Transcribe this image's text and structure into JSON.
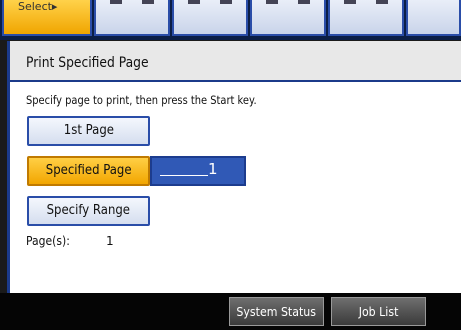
{
  "top_tabs": {
    "active_fragment": "Select▸"
  },
  "panel": {
    "title": "Print Specified Page",
    "instruction": "Specify page to print, then press the Start key.",
    "buttons": {
      "first_page": "1st Page",
      "specified_page": "Specified Page",
      "specify_range": "Specify Range"
    },
    "page_input": {
      "value": "1"
    },
    "pages": {
      "label": "Page(s):",
      "value": "1"
    }
  },
  "bottom_bar": {
    "system_status": "System Status",
    "job_list": "Job List"
  },
  "colors": {
    "accent_blue": "#2a4da8",
    "selected_orange": "#f2a600",
    "field_blue": "#3059b6"
  }
}
